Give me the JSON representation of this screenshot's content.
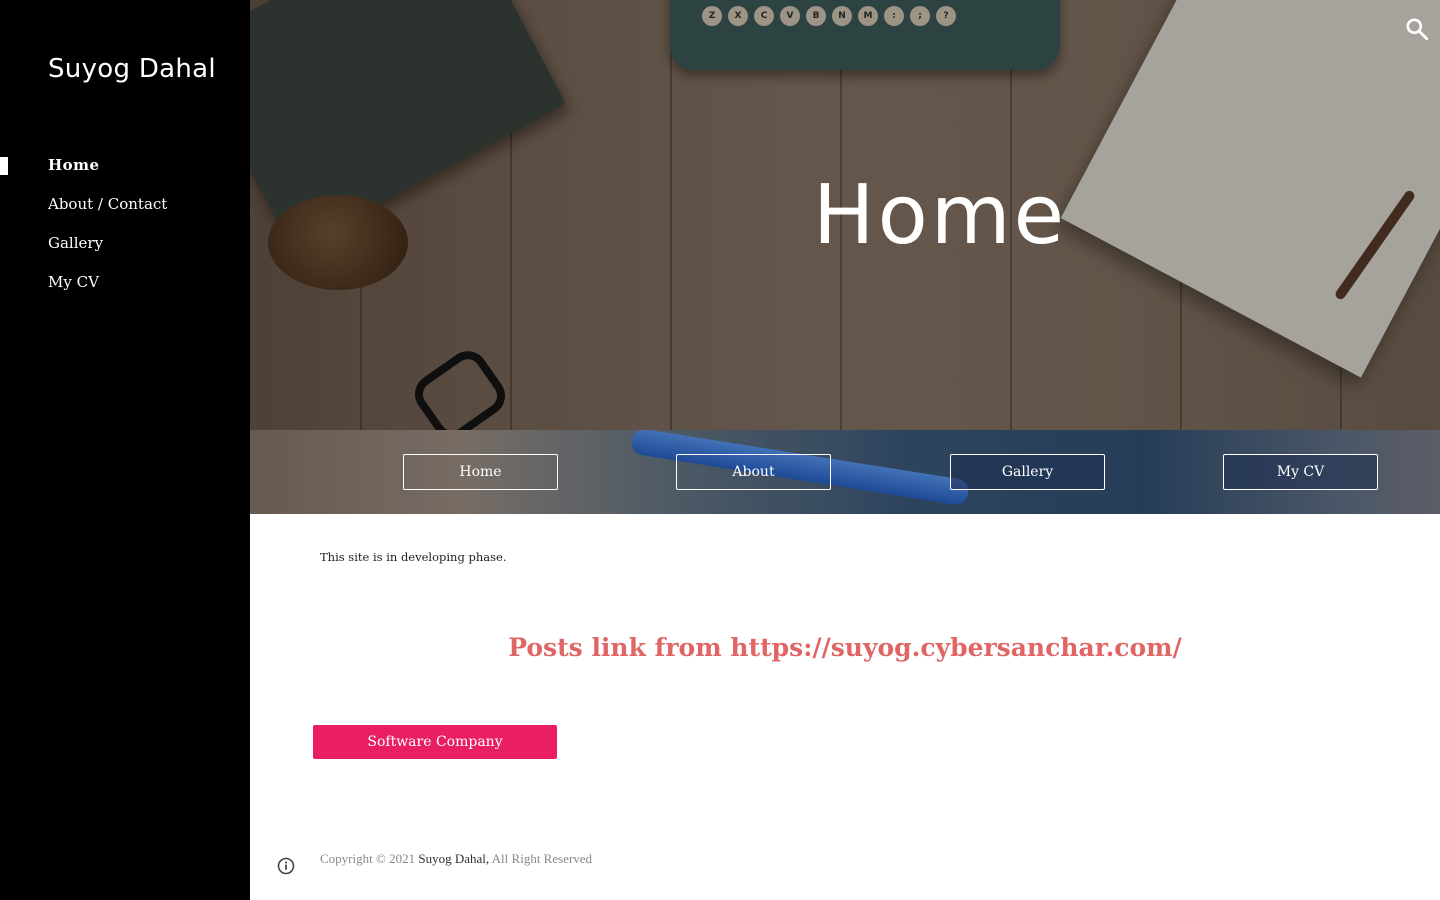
{
  "sidebar": {
    "title": "Suyog Dahal",
    "items": [
      {
        "label": "Home",
        "active": true
      },
      {
        "label": "About / Contact",
        "active": false
      },
      {
        "label": "Gallery",
        "active": false
      },
      {
        "label": "My CV",
        "active": false
      }
    ]
  },
  "hero": {
    "title": "Home",
    "typewriter_keys": [
      "Z",
      "X",
      "C",
      "V",
      "B",
      "N",
      "M",
      ":",
      ";",
      "?"
    ],
    "search_icon": "search-icon"
  },
  "band": {
    "buttons": [
      {
        "label": "Home"
      },
      {
        "label": "About"
      },
      {
        "label": "Gallery"
      },
      {
        "label": "My CV"
      }
    ]
  },
  "content": {
    "notice": "This site is in developing phase.",
    "posts_link": "Posts link from https://suyog.cybersanchar.com/",
    "cta_label": "Software Company"
  },
  "footer": {
    "prefix": "Copyright © 2021 ",
    "author": "Suyog Dahal,",
    "suffix": " All Right Reserved",
    "info_icon": "info-icon"
  },
  "colors": {
    "sidebar_bg": "#000000",
    "link_red": "#e06666",
    "cta_pink": "#e91e63"
  }
}
